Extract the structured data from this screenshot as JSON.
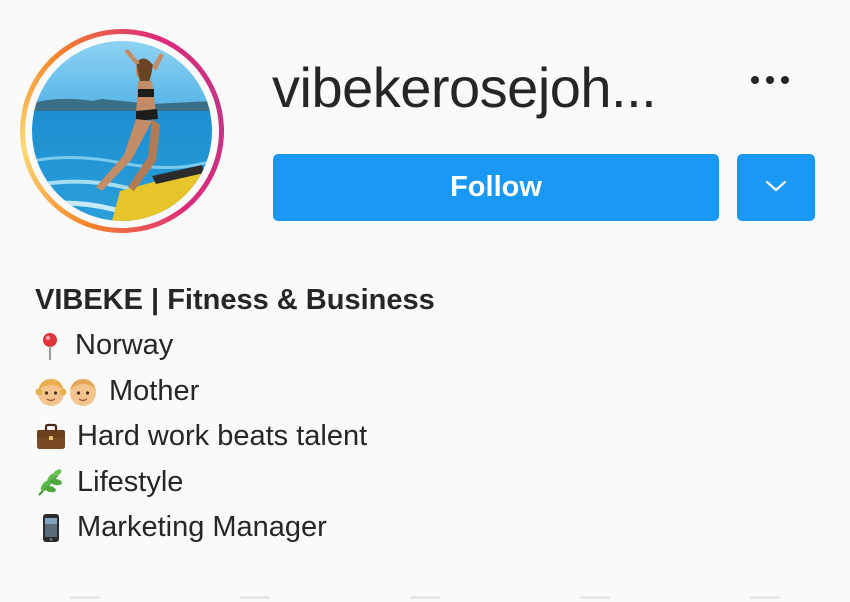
{
  "profile": {
    "username": "vibekerosejoh...",
    "follow_label": "Follow",
    "avatar_icon": "profile-photo",
    "more_icon": "more-options-icon",
    "dropdown_icon": "chevron-down-icon"
  },
  "bio": {
    "name": "VIBEKE | Fitness & Business",
    "lines": [
      {
        "icon": "pin-icon",
        "text": "Norway"
      },
      {
        "icon": "children-icon",
        "text": "Mother"
      },
      {
        "icon": "briefcase-icon",
        "text": "Hard work beats talent"
      },
      {
        "icon": "herb-icon",
        "text": "Lifestyle"
      },
      {
        "icon": "phone-icon",
        "text": "Marketing Manager"
      }
    ]
  },
  "colors": {
    "accent": "#1a98f5",
    "background": "#fafafa",
    "text": "#262626"
  }
}
